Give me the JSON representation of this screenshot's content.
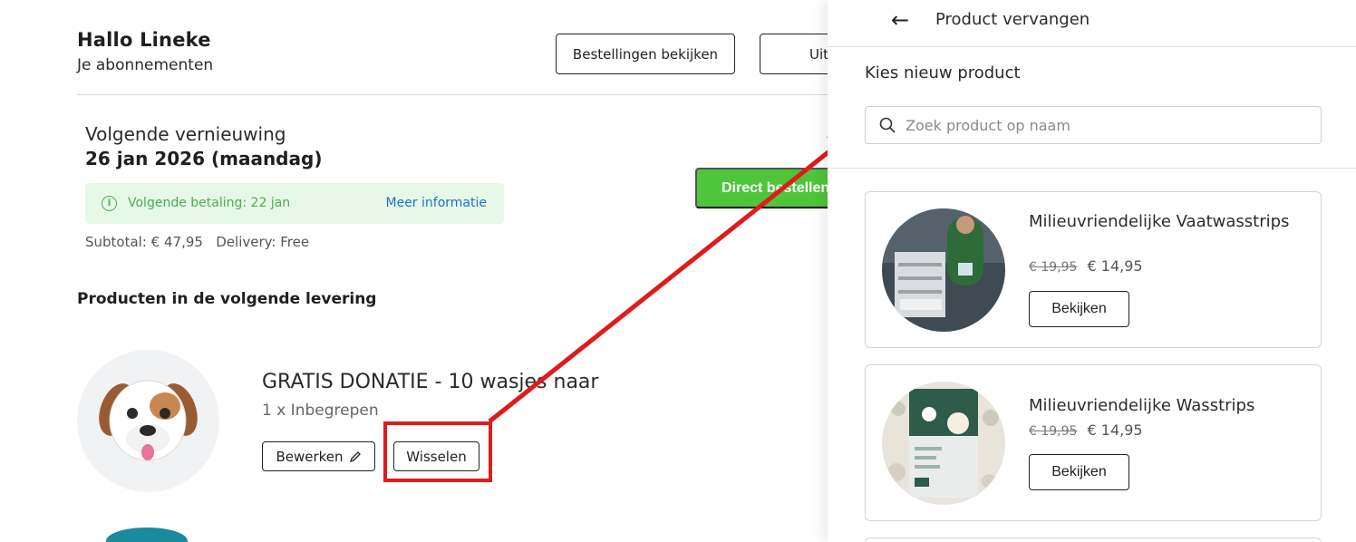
{
  "header": {
    "greeting": "Hallo Lineke",
    "subtitle": "Je abonnementen",
    "orders_button": "Bestellingen bekijken",
    "logout_button": "Uit"
  },
  "renewal": {
    "label": "Volgende vernieuwing",
    "date": "26 jan 2026 (maandag)",
    "payment_notice": "Volgende betaling: 22 jan",
    "more_info_link": "Meer informatie",
    "subtotal": "Subtotal: € 47,95",
    "delivery": "Delivery: Free",
    "direct_order_button": "Direct bestellen"
  },
  "products": {
    "heading": "Producten in de volgende levering",
    "items": [
      {
        "name": "GRATIS DONATIE - 10 wasjes naar",
        "quantity": "1 x Inbegrepen",
        "edit_label": "Bewerken",
        "swap_label": "Wisselen",
        "icon": "dog-face-icon"
      }
    ]
  },
  "panel": {
    "title": "Product vervangen",
    "choose_label": "Kies nieuw product",
    "search_placeholder": "Zoek product op naam",
    "cards": [
      {
        "name": "Milieuvriendelijke Vaatwasstrips",
        "old_price": "€ 19,95",
        "price": "€ 14,95",
        "button": "Bekijken",
        "image": "dishwasher-photo"
      },
      {
        "name": "Milieuvriendelijke Wasstrips",
        "old_price": "€ 19,95",
        "price": "€ 14,95",
        "button": "Bekijken",
        "image": "laundry-sheets-package"
      }
    ]
  },
  "colors": {
    "accent_green": "#4ec53a",
    "notice_bg": "#e7f7e8",
    "notice_text": "#4caf50",
    "link_blue": "#1a73c9",
    "annotation_red": "#e01b1b"
  }
}
